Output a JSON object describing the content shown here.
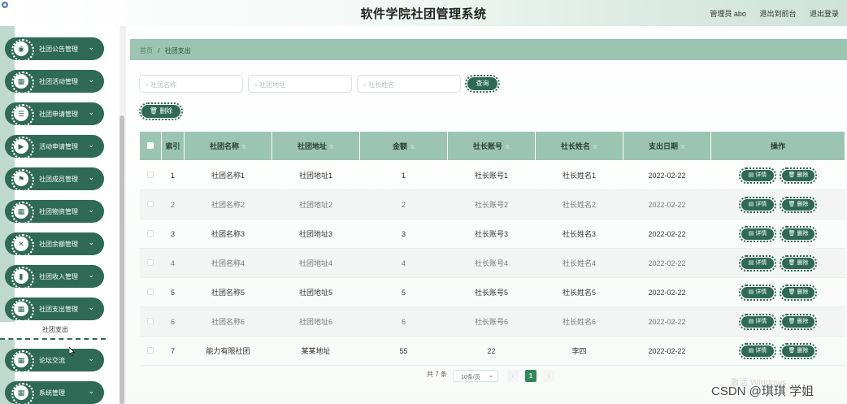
{
  "header": {
    "title": "软件学院社团管理系统",
    "user": "管理员 abo",
    "to_front": "退出到前台",
    "logout": "退出登录"
  },
  "sidebar": {
    "items": [
      {
        "label": "社团公告管理",
        "icon": "bell-icon",
        "glyph": "◉"
      },
      {
        "label": "社团活动管理",
        "icon": "grid-icon",
        "glyph": "▦"
      },
      {
        "label": "社团申请管理",
        "icon": "list-icon",
        "glyph": "☰"
      },
      {
        "label": "活动申请管理",
        "icon": "video-icon",
        "glyph": "▶"
      },
      {
        "label": "社团成员管理",
        "icon": "flag-icon",
        "glyph": "⚑"
      },
      {
        "label": "社团物资管理",
        "icon": "grid-icon",
        "glyph": "▦"
      },
      {
        "label": "社团余额管理",
        "icon": "shuffle-icon",
        "glyph": "✕"
      },
      {
        "label": "社团收入管理",
        "icon": "chart-icon",
        "glyph": "▮"
      },
      {
        "label": "社团支出管理",
        "icon": "grid-icon",
        "glyph": "▦"
      },
      {
        "label": "论坛交流",
        "icon": "grid-icon",
        "glyph": "▦"
      },
      {
        "label": "系统管理",
        "icon": "grid-icon",
        "glyph": "▦"
      }
    ],
    "sub_item": "社团支出"
  },
  "breadcrumb": {
    "home": "首页",
    "sep": "/",
    "current": "社团支出"
  },
  "search": {
    "name_placeholder": "社团名称",
    "addr_placeholder": "社团地址",
    "leader_placeholder": "社长姓名",
    "search_btn": "查询",
    "delete_btn": "删除"
  },
  "table": {
    "headers": [
      "索引",
      "社团名称",
      "社团地址",
      "金额",
      "社长账号",
      "社长姓名",
      "支出日期",
      "操作"
    ],
    "rows": [
      {
        "idx": "1",
        "name": "社团名称1",
        "addr": "社团地址1",
        "amount": "1",
        "account": "社长账号1",
        "leader": "社长姓名1",
        "date": "2022-02-22"
      },
      {
        "idx": "2",
        "name": "社团名称2",
        "addr": "社团地址2",
        "amount": "2",
        "account": "社长账号2",
        "leader": "社长姓名2",
        "date": "2022-02-22"
      },
      {
        "idx": "3",
        "name": "社团名称3",
        "addr": "社团地址3",
        "amount": "3",
        "account": "社长账号3",
        "leader": "社长姓名3",
        "date": "2022-02-22"
      },
      {
        "idx": "4",
        "name": "社团名称4",
        "addr": "社团地址4",
        "amount": "4",
        "account": "社长账号4",
        "leader": "社长姓名4",
        "date": "2022-02-22"
      },
      {
        "idx": "5",
        "name": "社团名称5",
        "addr": "社团地址5",
        "amount": "5",
        "account": "社长账号5",
        "leader": "社长姓名5",
        "date": "2022-02-22"
      },
      {
        "idx": "6",
        "name": "社团名称6",
        "addr": "社团地址6",
        "amount": "6",
        "account": "社长账号6",
        "leader": "社长姓名6",
        "date": "2022-02-22"
      },
      {
        "idx": "7",
        "name": "能力有限社团",
        "addr": "某某地址",
        "amount": "55",
        "account": "22",
        "leader": "李四",
        "date": "2022-02-22"
      }
    ],
    "detail_btn": "详情",
    "delete_btn": "删除"
  },
  "pagination": {
    "total": "共 7 条",
    "page_size": "10条/页",
    "current": "1",
    "prev": "‹",
    "next": "›"
  },
  "watermark": {
    "activate": "激活 Windows",
    "csdn": "CSDN @琪琪 学姐"
  },
  "colors": {
    "accent": "#2e6a55",
    "header_bg": "#9bc4b3",
    "active_page": "#2e8b57"
  }
}
